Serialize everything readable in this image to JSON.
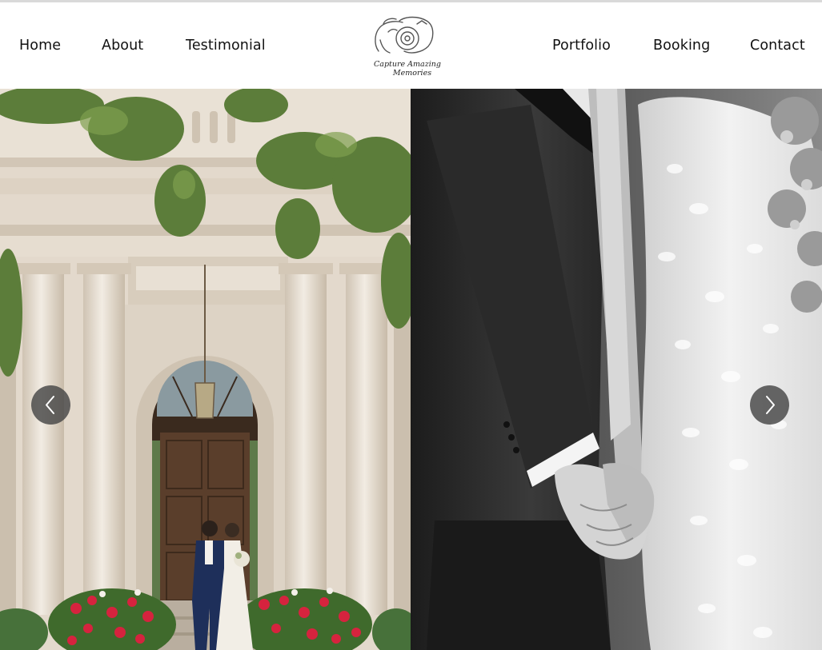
{
  "nav": {
    "left": [
      "Home",
      "About",
      "Testimonial"
    ],
    "right": [
      "Portfolio",
      "Booking",
      "Contact"
    ]
  },
  "logo": {
    "line1": "Capture Amazing",
    "line2": "Memories",
    "icon": "camera-outline-icon"
  },
  "slider": {
    "slides": [
      {
        "icon": "photo-couple-at-mansion-entrance"
      },
      {
        "icon": "photo-holding-hands-black-and-white"
      }
    ],
    "prev_icon": "chevron-left-icon",
    "next_icon": "chevron-right-icon"
  },
  "colors": {
    "arrow_bg": "#464646",
    "text": "#111111",
    "header_bg": "#ffffff"
  }
}
